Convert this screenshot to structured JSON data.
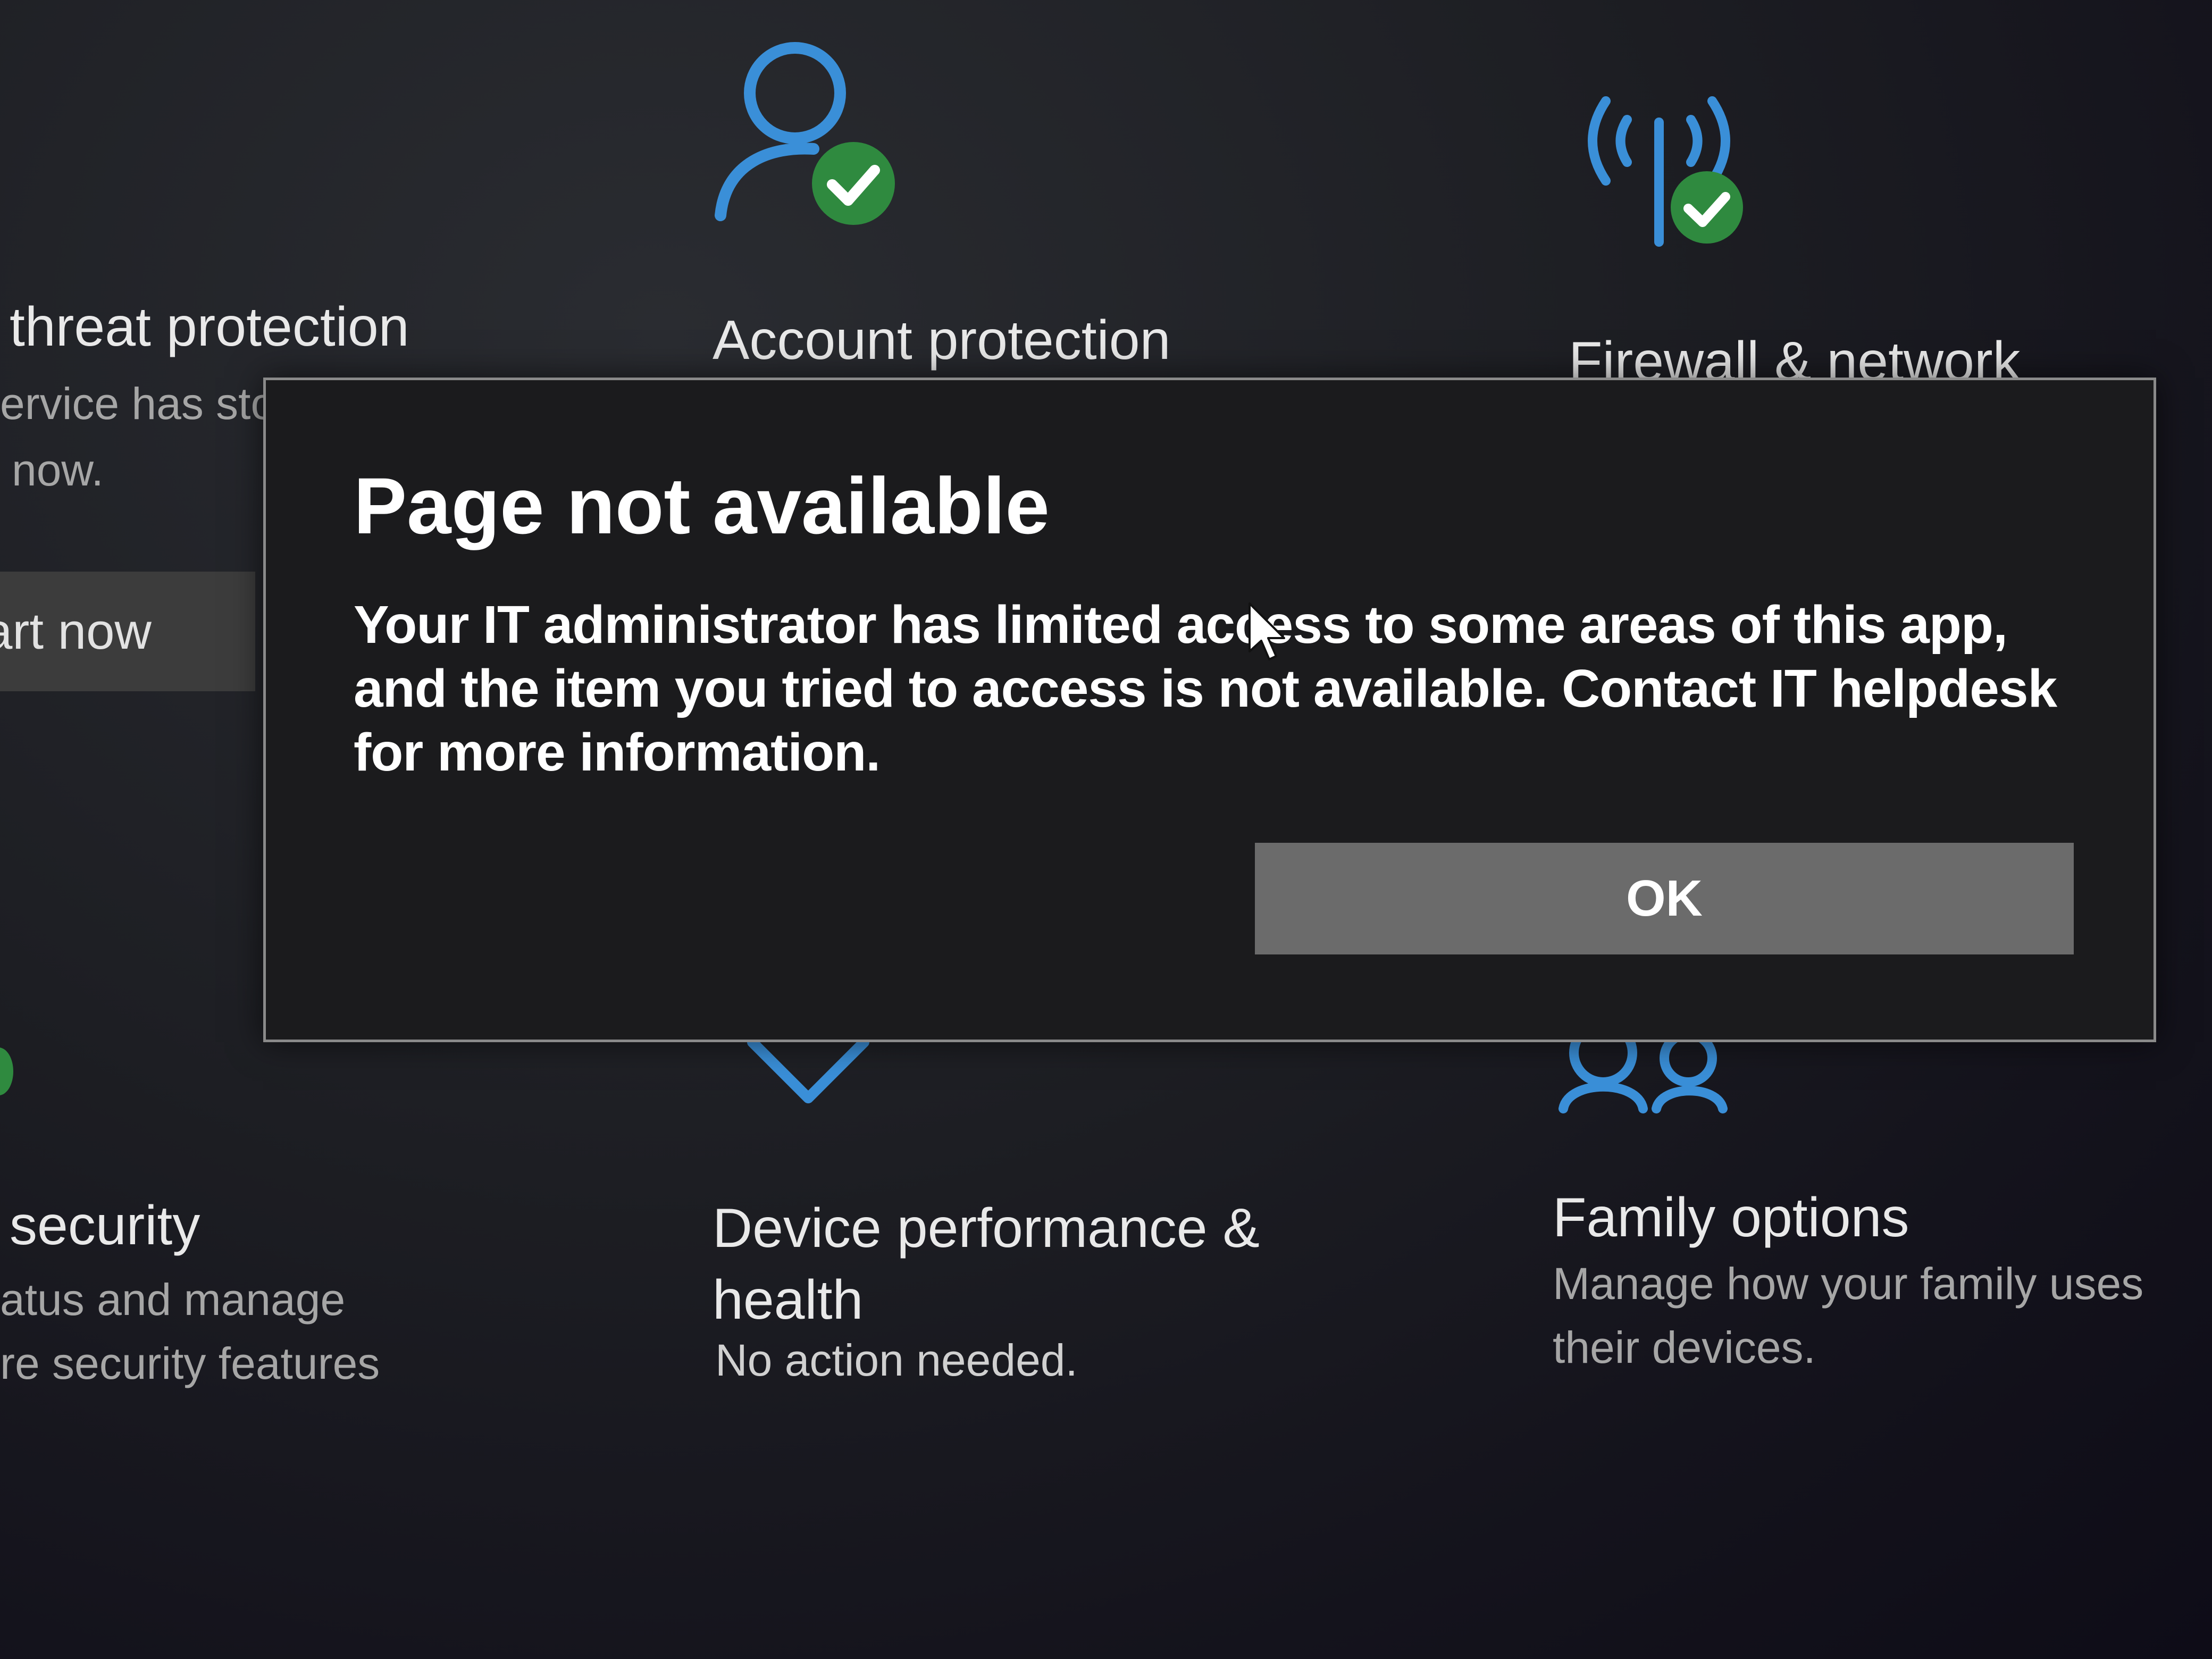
{
  "tiles": {
    "virus": {
      "title": "threat protection",
      "desc_line1": "ervice has sto",
      "desc_line2": "now.",
      "button_label": "art now"
    },
    "account": {
      "title": "Account protection",
      "icon": "account-check-icon"
    },
    "firewall": {
      "title": "Firewall & network",
      "icon": "antenna-check-icon"
    },
    "device_security": {
      "title": "security",
      "desc_line1": "atus and manage",
      "desc_line2": "re security features"
    },
    "device_performance": {
      "title_line1": "Device performance &",
      "title_line2": "health",
      "status": "No action needed.",
      "icon": "heart-icon"
    },
    "family": {
      "title": "Family options",
      "desc_line1": "Manage how your family uses",
      "desc_line2": "their devices.",
      "icon": "family-icon"
    }
  },
  "dialog": {
    "title": "Page not available",
    "message": "Your IT administrator has limited access to some areas of this app, and the item you tried to access is not available. Contact IT helpdesk for more information.",
    "ok_label": "OK"
  },
  "colors": {
    "accent": "#3a8fd8",
    "success": "#2f8a3f",
    "background": "#1d1e23",
    "dialog_bg": "#1b1b1d",
    "ok_button": "#6b6b6b"
  }
}
